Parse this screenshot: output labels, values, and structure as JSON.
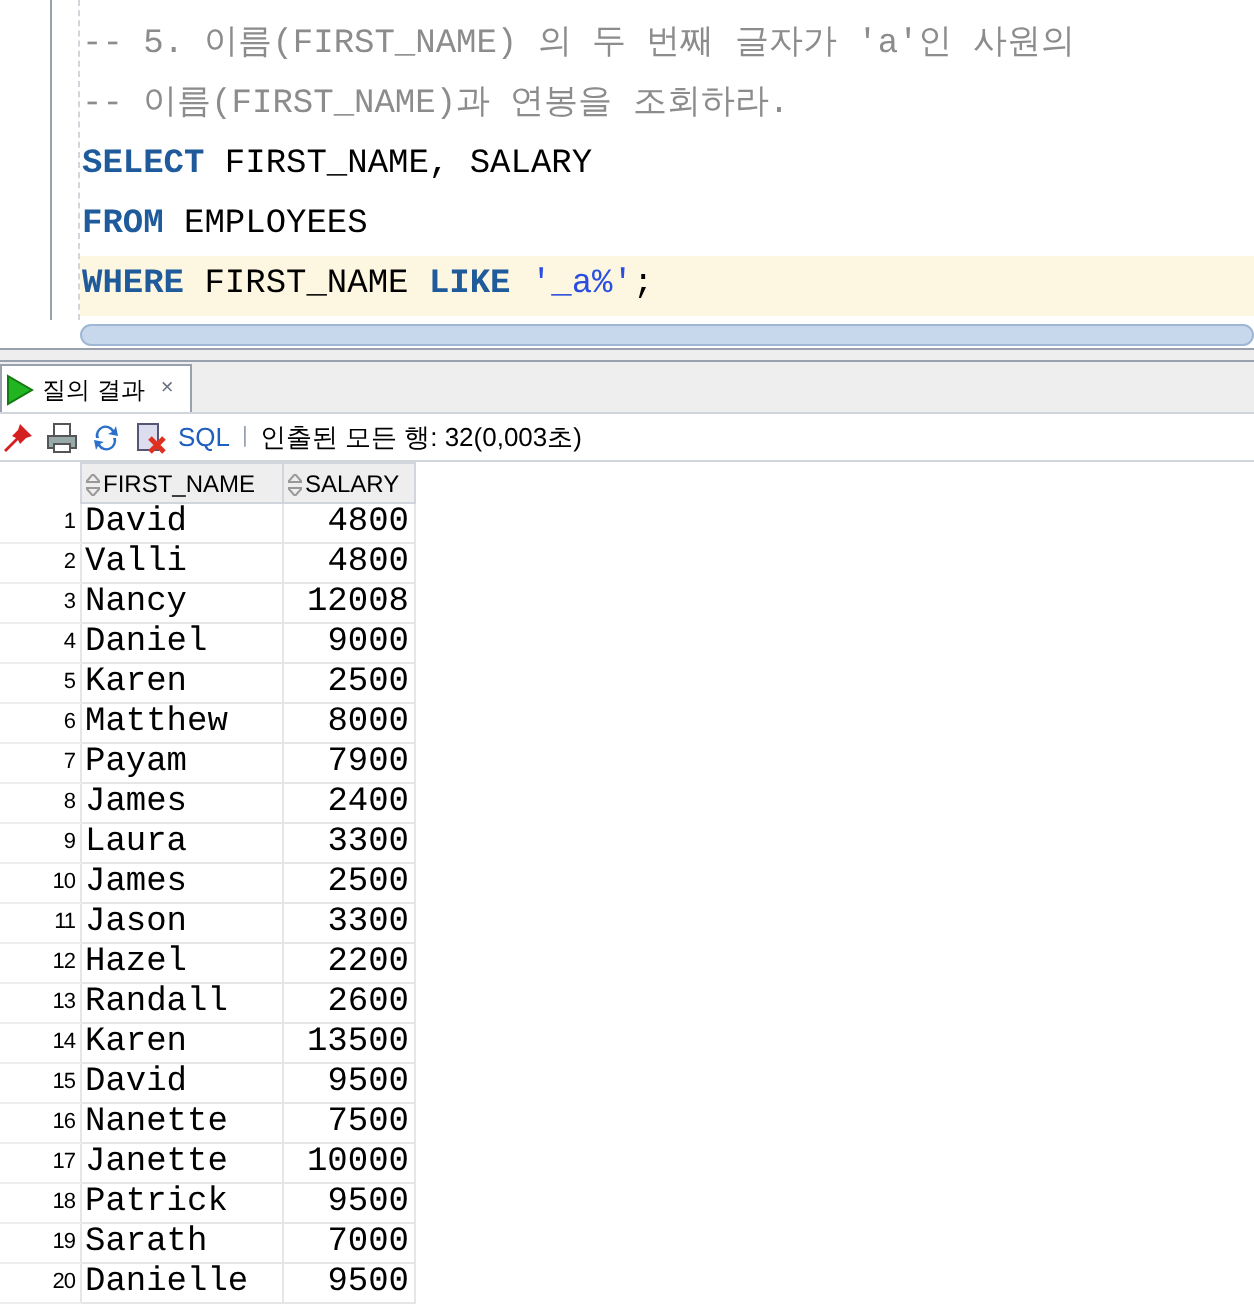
{
  "editor": {
    "lines": [
      {
        "kind": "comment",
        "text": "-- 5. 이름(FIRST_NAME) 의 두 번째 글자가 'a'인 사원의",
        "current": false
      },
      {
        "kind": "comment",
        "text": "-- 이름(FIRST_NAME)과 연봉을 조회하라.",
        "current": false
      },
      {
        "kind": "code",
        "tokens": [
          {
            "kind": "keyword",
            "text": "SELECT"
          },
          {
            "kind": "plain",
            "text": " FIRST_NAME, SALARY"
          }
        ],
        "current": false
      },
      {
        "kind": "code",
        "tokens": [
          {
            "kind": "keyword",
            "text": "FROM"
          },
          {
            "kind": "plain",
            "text": " EMPLOYEES"
          }
        ],
        "current": false
      },
      {
        "kind": "code",
        "tokens": [
          {
            "kind": "keyword",
            "text": "WHERE"
          },
          {
            "kind": "plain",
            "text": " FIRST_NAME "
          },
          {
            "kind": "keyword",
            "text": "LIKE"
          },
          {
            "kind": "string",
            "text": " '_a%'"
          },
          {
            "kind": "plain",
            "text": ";"
          }
        ],
        "current": true
      }
    ]
  },
  "results_tab": {
    "label": "질의 결과",
    "close": "×",
    "selected": true
  },
  "toolbar": {
    "sql_label": "SQL",
    "separator": "|",
    "status": "인출된 모든 행: 32(0,003초)"
  },
  "table": {
    "columns": [
      "",
      "FIRST_NAME",
      "SALARY"
    ],
    "rows": [
      [
        "1",
        "David",
        "4800"
      ],
      [
        "2",
        "Valli",
        "4800"
      ],
      [
        "3",
        "Nancy",
        "12008"
      ],
      [
        "4",
        "Daniel",
        "9000"
      ],
      [
        "5",
        "Karen",
        "2500"
      ],
      [
        "6",
        "Matthew",
        "8000"
      ],
      [
        "7",
        "Payam",
        "7900"
      ],
      [
        "8",
        "James",
        "2400"
      ],
      [
        "9",
        "Laura",
        "3300"
      ],
      [
        "10",
        "James",
        "2500"
      ],
      [
        "11",
        "Jason",
        "3300"
      ],
      [
        "12",
        "Hazel",
        "2200"
      ],
      [
        "13",
        "Randall",
        "2600"
      ],
      [
        "14",
        "Karen",
        "13500"
      ],
      [
        "15",
        "David",
        "9500"
      ],
      [
        "16",
        "Nanette",
        "7500"
      ],
      [
        "17",
        "Janette",
        "10000"
      ],
      [
        "18",
        "Patrick",
        "9500"
      ],
      [
        "19",
        "Sarath",
        "7000"
      ],
      [
        "20",
        "Danielle",
        "9500"
      ]
    ]
  }
}
